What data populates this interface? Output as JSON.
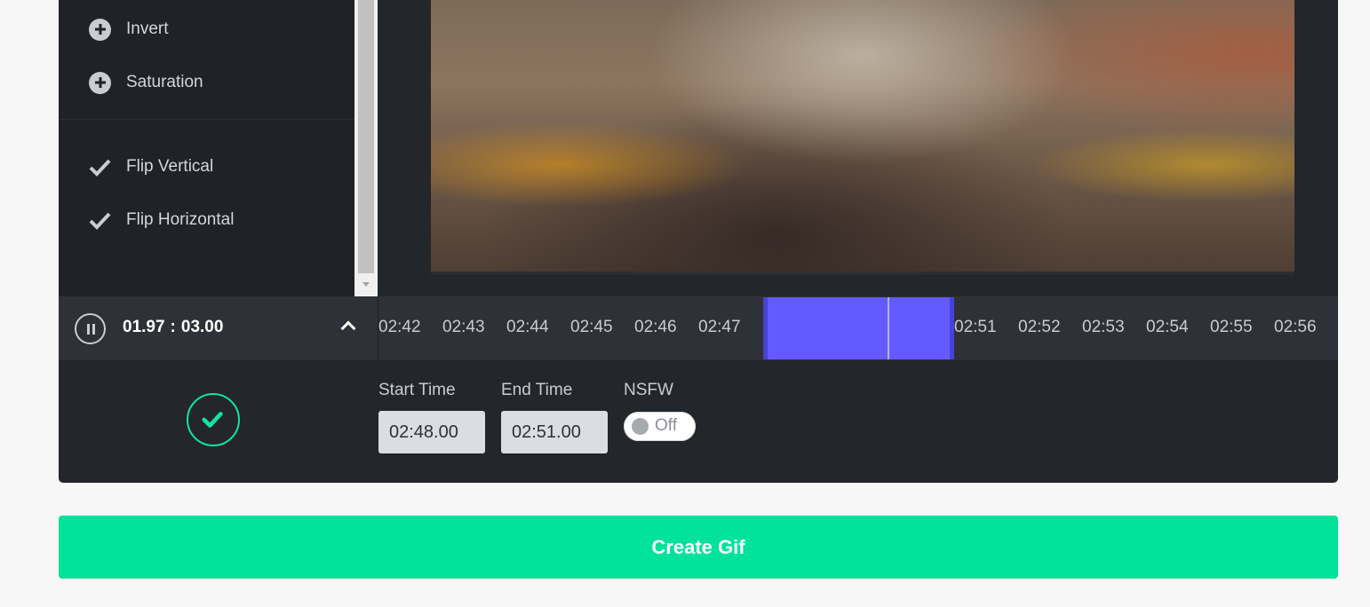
{
  "sidebar": {
    "adjustments": [
      {
        "label": "Invert",
        "icon": "plus-circle-icon"
      },
      {
        "label": "Saturation",
        "icon": "plus-circle-icon"
      }
    ],
    "toggles": [
      {
        "label": "Flip Vertical",
        "icon": "checkmark-icon"
      },
      {
        "label": "Flip Horizontal",
        "icon": "checkmark-icon"
      }
    ]
  },
  "player": {
    "current_time": "01.97",
    "separator": ":",
    "duration": "03.00"
  },
  "timeline": {
    "ticks_before": [
      "02:42",
      "02:43",
      "02:44",
      "02:45",
      "02:46",
      "02:47"
    ],
    "ticks_after": [
      "02:51",
      "02:52",
      "02:53",
      "02:54",
      "02:55",
      "02:56"
    ],
    "selection_color": "#635bff"
  },
  "clip": {
    "start_label": "Start Time",
    "start_value": "02:48.00",
    "end_label": "End Time",
    "end_value": "02:51.00",
    "nsfw_label": "NSFW",
    "nsfw_state": "Off"
  },
  "actions": {
    "create_label": "Create Gif"
  },
  "colors": {
    "accent": "#00e29a",
    "panel_bg": "#23262b"
  }
}
